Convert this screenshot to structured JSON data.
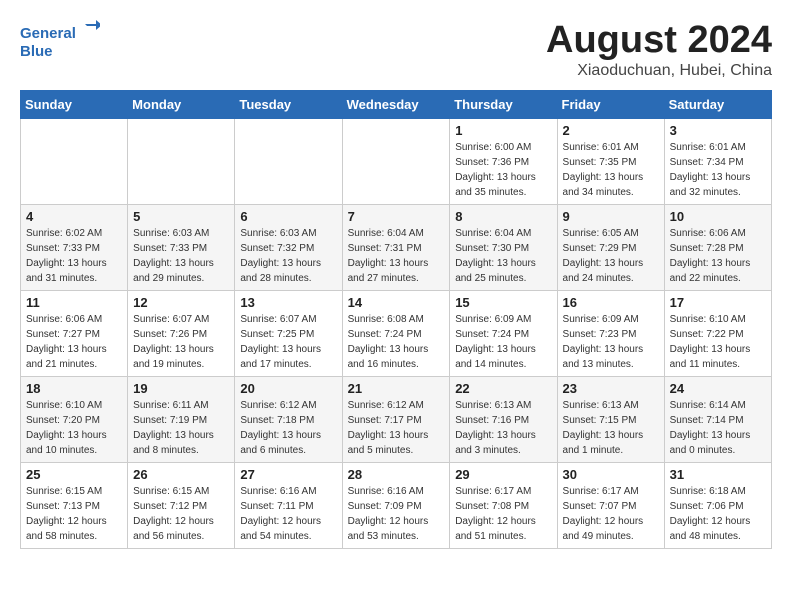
{
  "logo": {
    "line1": "General",
    "line2": "Blue"
  },
  "title": "August 2024",
  "subtitle": "Xiaoduchuan, Hubei, China",
  "weekdays": [
    "Sunday",
    "Monday",
    "Tuesday",
    "Wednesday",
    "Thursday",
    "Friday",
    "Saturday"
  ],
  "weeks": [
    [
      {
        "day": "",
        "info": ""
      },
      {
        "day": "",
        "info": ""
      },
      {
        "day": "",
        "info": ""
      },
      {
        "day": "",
        "info": ""
      },
      {
        "day": "1",
        "info": "Sunrise: 6:00 AM\nSunset: 7:36 PM\nDaylight: 13 hours\nand 35 minutes."
      },
      {
        "day": "2",
        "info": "Sunrise: 6:01 AM\nSunset: 7:35 PM\nDaylight: 13 hours\nand 34 minutes."
      },
      {
        "day": "3",
        "info": "Sunrise: 6:01 AM\nSunset: 7:34 PM\nDaylight: 13 hours\nand 32 minutes."
      }
    ],
    [
      {
        "day": "4",
        "info": "Sunrise: 6:02 AM\nSunset: 7:33 PM\nDaylight: 13 hours\nand 31 minutes."
      },
      {
        "day": "5",
        "info": "Sunrise: 6:03 AM\nSunset: 7:33 PM\nDaylight: 13 hours\nand 29 minutes."
      },
      {
        "day": "6",
        "info": "Sunrise: 6:03 AM\nSunset: 7:32 PM\nDaylight: 13 hours\nand 28 minutes."
      },
      {
        "day": "7",
        "info": "Sunrise: 6:04 AM\nSunset: 7:31 PM\nDaylight: 13 hours\nand 27 minutes."
      },
      {
        "day": "8",
        "info": "Sunrise: 6:04 AM\nSunset: 7:30 PM\nDaylight: 13 hours\nand 25 minutes."
      },
      {
        "day": "9",
        "info": "Sunrise: 6:05 AM\nSunset: 7:29 PM\nDaylight: 13 hours\nand 24 minutes."
      },
      {
        "day": "10",
        "info": "Sunrise: 6:06 AM\nSunset: 7:28 PM\nDaylight: 13 hours\nand 22 minutes."
      }
    ],
    [
      {
        "day": "11",
        "info": "Sunrise: 6:06 AM\nSunset: 7:27 PM\nDaylight: 13 hours\nand 21 minutes."
      },
      {
        "day": "12",
        "info": "Sunrise: 6:07 AM\nSunset: 7:26 PM\nDaylight: 13 hours\nand 19 minutes."
      },
      {
        "day": "13",
        "info": "Sunrise: 6:07 AM\nSunset: 7:25 PM\nDaylight: 13 hours\nand 17 minutes."
      },
      {
        "day": "14",
        "info": "Sunrise: 6:08 AM\nSunset: 7:24 PM\nDaylight: 13 hours\nand 16 minutes."
      },
      {
        "day": "15",
        "info": "Sunrise: 6:09 AM\nSunset: 7:24 PM\nDaylight: 13 hours\nand 14 minutes."
      },
      {
        "day": "16",
        "info": "Sunrise: 6:09 AM\nSunset: 7:23 PM\nDaylight: 13 hours\nand 13 minutes."
      },
      {
        "day": "17",
        "info": "Sunrise: 6:10 AM\nSunset: 7:22 PM\nDaylight: 13 hours\nand 11 minutes."
      }
    ],
    [
      {
        "day": "18",
        "info": "Sunrise: 6:10 AM\nSunset: 7:20 PM\nDaylight: 13 hours\nand 10 minutes."
      },
      {
        "day": "19",
        "info": "Sunrise: 6:11 AM\nSunset: 7:19 PM\nDaylight: 13 hours\nand 8 minutes."
      },
      {
        "day": "20",
        "info": "Sunrise: 6:12 AM\nSunset: 7:18 PM\nDaylight: 13 hours\nand 6 minutes."
      },
      {
        "day": "21",
        "info": "Sunrise: 6:12 AM\nSunset: 7:17 PM\nDaylight: 13 hours\nand 5 minutes."
      },
      {
        "day": "22",
        "info": "Sunrise: 6:13 AM\nSunset: 7:16 PM\nDaylight: 13 hours\nand 3 minutes."
      },
      {
        "day": "23",
        "info": "Sunrise: 6:13 AM\nSunset: 7:15 PM\nDaylight: 13 hours\nand 1 minute."
      },
      {
        "day": "24",
        "info": "Sunrise: 6:14 AM\nSunset: 7:14 PM\nDaylight: 13 hours\nand 0 minutes."
      }
    ],
    [
      {
        "day": "25",
        "info": "Sunrise: 6:15 AM\nSunset: 7:13 PM\nDaylight: 12 hours\nand 58 minutes."
      },
      {
        "day": "26",
        "info": "Sunrise: 6:15 AM\nSunset: 7:12 PM\nDaylight: 12 hours\nand 56 minutes."
      },
      {
        "day": "27",
        "info": "Sunrise: 6:16 AM\nSunset: 7:11 PM\nDaylight: 12 hours\nand 54 minutes."
      },
      {
        "day": "28",
        "info": "Sunrise: 6:16 AM\nSunset: 7:09 PM\nDaylight: 12 hours\nand 53 minutes."
      },
      {
        "day": "29",
        "info": "Sunrise: 6:17 AM\nSunset: 7:08 PM\nDaylight: 12 hours\nand 51 minutes."
      },
      {
        "day": "30",
        "info": "Sunrise: 6:17 AM\nSunset: 7:07 PM\nDaylight: 12 hours\nand 49 minutes."
      },
      {
        "day": "31",
        "info": "Sunrise: 6:18 AM\nSunset: 7:06 PM\nDaylight: 12 hours\nand 48 minutes."
      }
    ]
  ]
}
